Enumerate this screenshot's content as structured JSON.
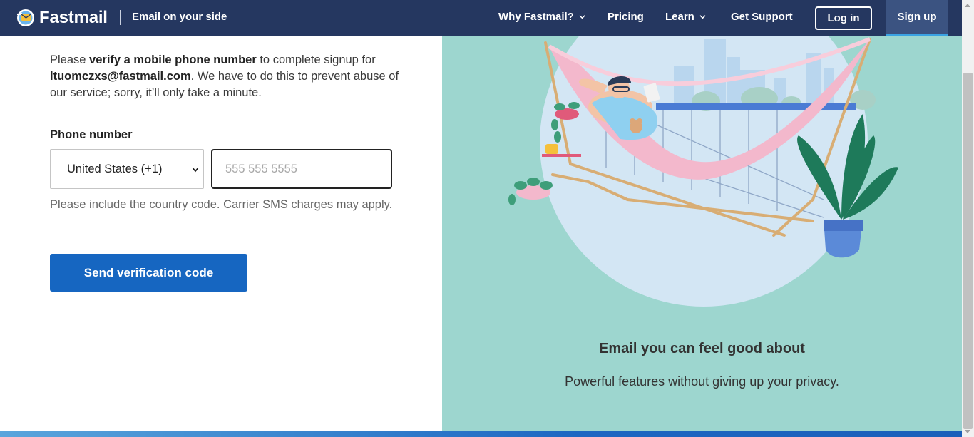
{
  "header": {
    "brand": "Fastmail",
    "tagline": "Email on your side",
    "nav": [
      {
        "label": "Why Fastmail?",
        "dropdown": true
      },
      {
        "label": "Pricing",
        "dropdown": false
      },
      {
        "label": "Learn",
        "dropdown": true
      },
      {
        "label": "Get Support",
        "dropdown": false
      }
    ],
    "login_label": "Log in",
    "signup_label": "Sign up"
  },
  "form": {
    "intro_pre": "Please ",
    "intro_bold1": "verify a mobile phone number",
    "intro_mid": " to complete signup for ",
    "intro_email": "ltuomczxs@fastmail.com",
    "intro_post": ". We have to do this to prevent abuse of our service; sorry, it’ll only take a minute.",
    "phone_label": "Phone number",
    "country_selected": "United States (+1)",
    "phone_value": "",
    "phone_placeholder": "555 555 5555",
    "hint": "Please include the country code. Carrier SMS charges may apply.",
    "send_label": "Send verification code"
  },
  "promo": {
    "title": "Email you can feel good about",
    "subtitle": "Powerful features without giving up your privacy."
  },
  "colors": {
    "header_bg": "#253760",
    "signup_bg": "#3b5381",
    "button_blue": "#1666c1",
    "panel_teal": "#9dd6cf"
  }
}
